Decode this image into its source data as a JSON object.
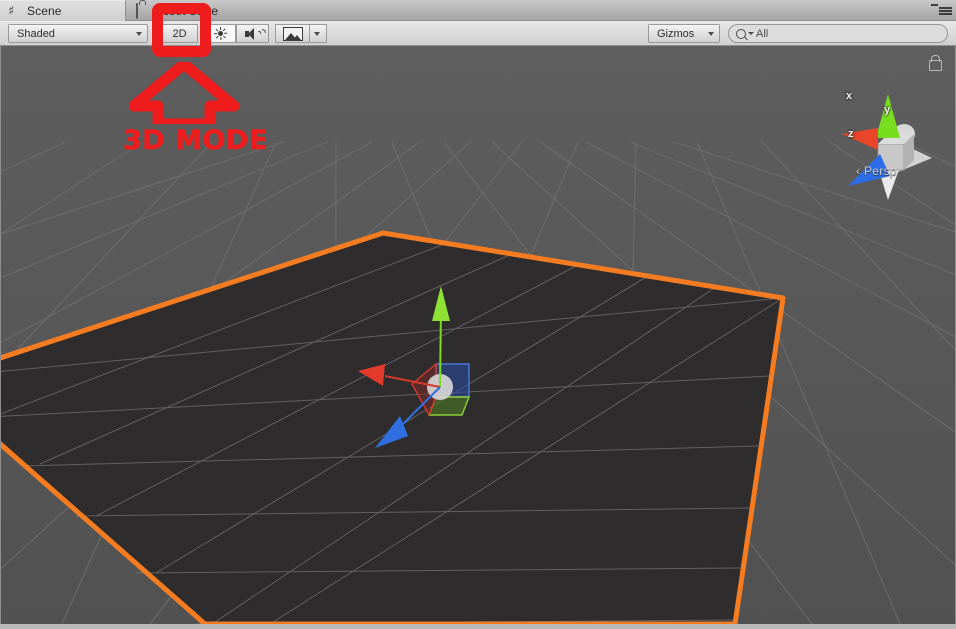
{
  "window": {
    "tabs": [
      {
        "label": "Scene",
        "icon": "grid-hash-icon",
        "active": true
      },
      {
        "label": "Asset Store",
        "icon": "shopping-bag-icon",
        "active": false
      }
    ],
    "panel_menu_icon": "panel-menu-icon"
  },
  "toolbar": {
    "draw_mode": {
      "label": "Shaded",
      "icon": "chevron-down-icon"
    },
    "toggle_2d": {
      "label": "2D",
      "active": false
    },
    "lighting": {
      "icon": "sun-icon",
      "active": true
    },
    "audio": {
      "icon": "speaker-icon",
      "active": false
    },
    "effects": {
      "icon": "image-icon",
      "dropdown_icon": "chevron-down-icon"
    },
    "gizmos": {
      "label": "Gizmos",
      "icon": "chevron-down-icon"
    },
    "search": {
      "value": "",
      "placeholder": "All",
      "icon": "search-icon",
      "dropdown_icon": "chevron-down-icon"
    }
  },
  "scene": {
    "gizmo": {
      "axes": [
        {
          "label": "y",
          "color": "#77dd1e"
        },
        {
          "label": "x",
          "color": "#e8452a"
        },
        {
          "label": "z",
          "color": "#2d6de8"
        }
      ],
      "projection_label": "Persp",
      "projection_prefix_icon": "chevron-left-icon",
      "lock_icon": "lock-open-icon"
    },
    "selection": {
      "outline_color": "#f57c20",
      "object_fill": "#2e2c2c"
    },
    "transform_gizmo": {
      "x_axis_color": "#d6382c",
      "y_axis_color": "#7ade20",
      "z_axis_color": "#2f6fe0"
    },
    "background_color": "#585858",
    "grid_color": "#6e6e6e"
  },
  "annotation": {
    "highlight_color": "#ee1c1c",
    "highlight_target": "2D",
    "arrow_icon": "arrow-up-icon",
    "text": "3D MODE"
  }
}
